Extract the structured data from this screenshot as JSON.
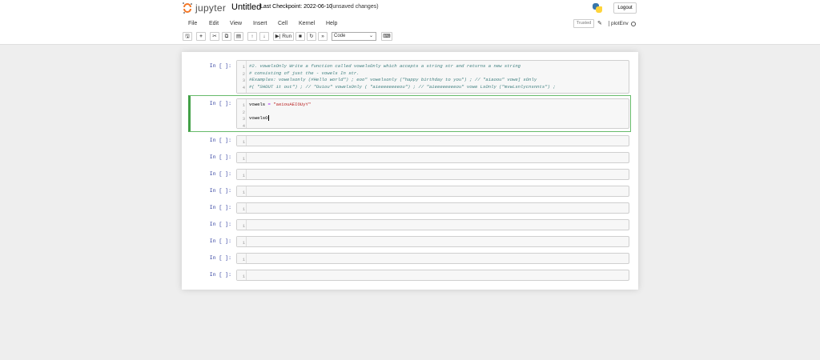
{
  "header": {
    "logo_text": "jupyter",
    "notebook_title": "Untitled",
    "checkpoint": "Last Checkpoint: 2022-06-10",
    "unsaved": "(unsaved changes)",
    "logout_label": "Logout"
  },
  "menu": [
    "File",
    "Edit",
    "View",
    "Insert",
    "Cell",
    "Kernel",
    "Help"
  ],
  "kernel": {
    "trusted_label": "Trusted",
    "name": "plotEnv"
  },
  "toolbar": {
    "run_label": "Run",
    "cell_type": "Code",
    "icons": [
      "save-icon",
      "plus-icon",
      "cut-icon",
      "copy-icon",
      "paste-icon",
      "arrow-up-icon",
      "arrow-down-icon",
      "run-icon",
      "stop-icon",
      "restart-icon",
      "fast-forward-icon",
      "keyboard-icon"
    ]
  },
  "cells": [
    {
      "prompt": "In [ ]:",
      "line_numbers": [
        "1",
        "2",
        "3",
        "4"
      ],
      "lines": [
        "#2. vowelsOnly Write a function called vowelsOnly which accepts a string str and returns a new string",
        "# consisting of just the - vowels In str.",
        "#Examples: vowelsonly (#Hello world\") ; eoo\" vowelsonly (\"happy birthday to you\") ; // \"aiaoou\" vowe] sOnly",
        "#( \"SHOUT it out\") ; // \"Ouiou\" vowelsOnly ( \"aieeeeeeeeou\") ; // \"aieeeeeeeeou\" vowe LsOnly (\"mvwLsnlycnsnnts\") ;"
      ]
    },
    {
      "prompt": "In [ ]:",
      "line_numbers": [
        "1",
        "2",
        "3",
        "4"
      ],
      "line1_var": "vowels",
      "line1_eq": "=",
      "line1_str": "\"aeiouAEIOUyY\"",
      "line3": "vowelsO"
    },
    {
      "prompt": "In [ ]:",
      "ln": "1"
    },
    {
      "prompt": "In [ ]:",
      "ln": "1"
    },
    {
      "prompt": "In [ ]:",
      "ln": "1"
    },
    {
      "prompt": "In [ ]:",
      "ln": "1"
    },
    {
      "prompt": "In [ ]:",
      "ln": "1"
    },
    {
      "prompt": "In [ ]:",
      "ln": "1"
    },
    {
      "prompt": "In [ ]:",
      "ln": "1"
    },
    {
      "prompt": "In [ ]:",
      "ln": "1"
    },
    {
      "prompt": "In [ ]:",
      "ln": "1"
    }
  ]
}
